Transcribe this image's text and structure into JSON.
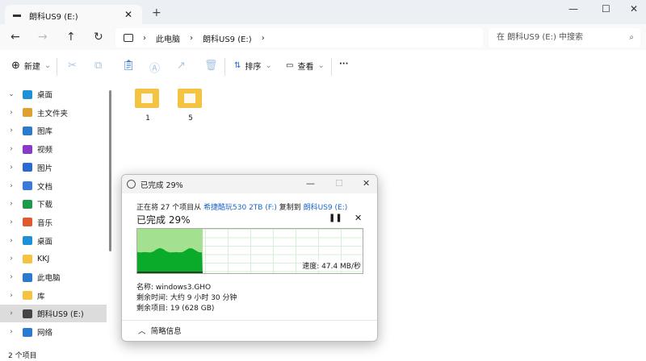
{
  "tab": {
    "title": "朗科US9 (E:)",
    "new_tab": "+"
  },
  "window": {
    "minimize": "—",
    "maximize": "☐",
    "close": "✕"
  },
  "nav": {
    "back": "←",
    "forward": "→",
    "up": "↑",
    "refresh": "↻"
  },
  "breadcrumb": [
    "此电脑",
    "朗科US9 (E:)"
  ],
  "search": {
    "placeholder": "在 朗科US9 (E:) 中搜索"
  },
  "toolbar": {
    "new": "新建",
    "sort": "排序",
    "view": "查看",
    "more": "···"
  },
  "sidebar": [
    {
      "label": "桌面",
      "chev": "⌄",
      "color": "#1e90d6"
    },
    {
      "label": "主文件夹",
      "chev": "›",
      "color": "#e0a030"
    },
    {
      "label": "图库",
      "chev": "›",
      "color": "#2a7ad0"
    },
    {
      "label": "视频",
      "chev": "›",
      "color": "#8a3ac8"
    },
    {
      "label": "图片",
      "chev": "›",
      "color": "#2a6ad0"
    },
    {
      "label": "文档",
      "chev": "›",
      "color": "#3a7ad8"
    },
    {
      "label": "下载",
      "chev": "›",
      "color": "#1a9a4a"
    },
    {
      "label": "音乐",
      "chev": "›",
      "color": "#e05a30"
    },
    {
      "label": "桌面",
      "chev": "›",
      "color": "#1e90d6"
    },
    {
      "label": "KKJ",
      "chev": "›",
      "color": "#f5c342"
    },
    {
      "label": "此电脑",
      "chev": "›",
      "color": "#2a7ad0"
    },
    {
      "label": "库",
      "chev": "›",
      "color": "#f5c342"
    },
    {
      "label": "朗科US9 (E:)",
      "chev": "›",
      "color": "#444"
    },
    {
      "label": "网络",
      "chev": "›",
      "color": "#2a7ad0"
    }
  ],
  "folders": [
    {
      "name": "1"
    },
    {
      "name": "5"
    }
  ],
  "status": "2 个项目",
  "dialog": {
    "title": "已完成 29%",
    "line_prefix": "正在将 27 个项目从 ",
    "source": "希捷酷玩530 2TB (F:)",
    "line_mid": " 复制到 ",
    "dest": "朗科US9 (E:)",
    "percent_label": "已完成 29%",
    "progress": 29,
    "speed": "速度: 47.4 MB/秒",
    "name": "名称: windows3.GHO",
    "time_left": "剩余时间: 大约 9 小时 30 分钟",
    "items_left": "剩余项目: 19 (628 GB)",
    "less_details": "简略信息"
  }
}
